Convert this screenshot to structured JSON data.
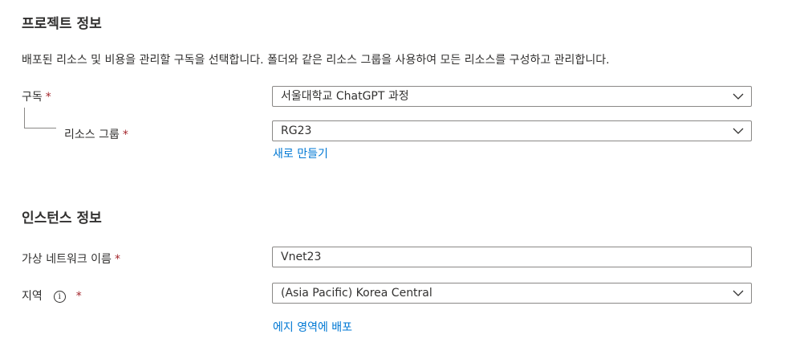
{
  "project": {
    "title": "프로젝트 정보",
    "description": "배포된 리소스 및 비용을 관리할 구독을 선택합니다. 폴더와 같은 리소스 그룹을 사용하여 모든 리소스를 구성하고 관리합니다.",
    "subscription_label": "구독",
    "subscription_value": "서울대학교 ChatGPT 과정",
    "resource_group_label": "리소스 그룹",
    "resource_group_value": "RG23",
    "create_new_link": "새로 만들기",
    "required_mark": "*"
  },
  "instance": {
    "title": "인스턴스 정보",
    "vnet_name_label": "가상 네트워크 이름",
    "vnet_name_value": "Vnet23",
    "region_label": "지역",
    "region_value": "(Asia Pacific) Korea Central",
    "edge_zone_link": "에지 영역에 배포",
    "info_icon": "info-icon",
    "required_mark": "*"
  },
  "icons": {
    "dropdown": "chevron-down-icon"
  },
  "colors": {
    "link": "#0078d4",
    "required": "#a4262c",
    "border": "#8a8886",
    "text": "#323130"
  }
}
